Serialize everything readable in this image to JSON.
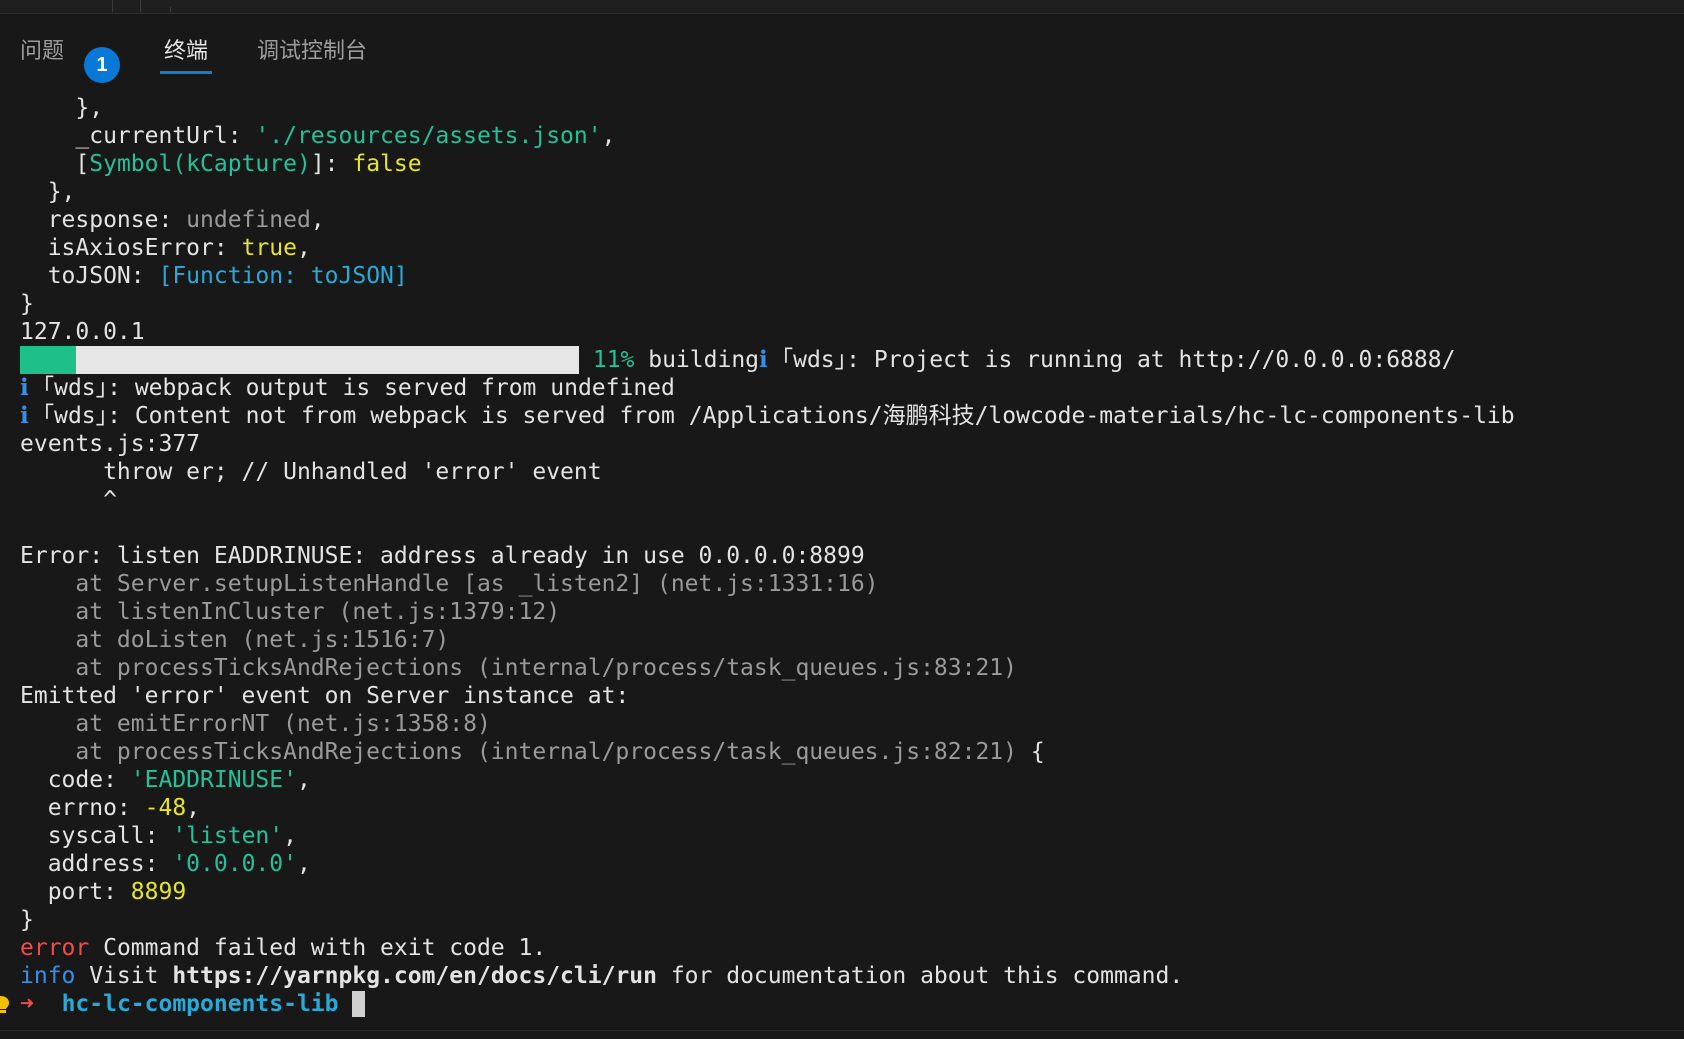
{
  "panel": {
    "tabs": {
      "problems": "问题",
      "problems_count": "1",
      "terminal": "终端",
      "debug_console": "调试控制台"
    }
  },
  "terminal": {
    "l01": "    },",
    "l02_key": "    _currentUrl: ",
    "l02_val": "'./resources/assets.json'",
    "l02_end": ",",
    "l03_open": "    [",
    "l03_sym": "Symbol(kCapture)",
    "l03_close": "]: ",
    "l03_val": "false",
    "l04": "  },",
    "l05_key": "  response: ",
    "l05_val": "undefined",
    "l05_end": ",",
    "l06_key": "  isAxiosError: ",
    "l06_val": "true",
    "l06_end": ",",
    "l07_key": "  toJSON: ",
    "l07_val": "[Function: toJSON]",
    "l08": "}",
    "l09": "127.0.0.1",
    "progress_percent": 10,
    "l10_pct": " 11%",
    "l10_text": " building",
    "l10_info": "ℹ",
    "l10_rest": " ｢wds｣: Project is running at http://0.0.0.0:6888/",
    "l11_info": "ℹ",
    "l11_rest": " ｢wds｣: webpack output is served from undefined",
    "l12_info": "ℹ",
    "l12_rest": " ｢wds｣: Content not from webpack is served from /Applications/海鹏科技/lowcode-materials/hc-lc-components-lib",
    "l13": "events.js:377",
    "l14": "      throw er; // Unhandled 'error' event",
    "l15": "      ^",
    "l16": "",
    "l17": "Error: listen EADDRINUSE: address already in use 0.0.0.0:8899",
    "l18": "    at Server.setupListenHandle [as _listen2] (net.js:1331:16)",
    "l19": "    at listenInCluster (net.js:1379:12)",
    "l20": "    at doListen (net.js:1516:7)",
    "l21": "    at processTicksAndRejections (internal/process/task_queues.js:83:21)",
    "l22": "Emitted 'error' event on Server instance at:",
    "l23": "    at emitErrorNT (net.js:1358:8)",
    "l24_dim": "    at processTicksAndRejections (internal/process/task_queues.js:82:21)",
    "l24_end": " {",
    "l25_key": "  code: ",
    "l25_val": "'EADDRINUSE'",
    "l25_end": ",",
    "l26_key": "  errno: ",
    "l26_val": "-48",
    "l26_end": ",",
    "l27_key": "  syscall: ",
    "l27_val": "'listen'",
    "l27_end": ",",
    "l28_key": "  address: ",
    "l28_val": "'0.0.0.0'",
    "l28_end": ",",
    "l29_key": "  port: ",
    "l29_val": "8899",
    "l30": "}",
    "l31_tag": "error",
    "l31_rest": " Command failed with exit code 1.",
    "l32_tag": "info",
    "l32_mid": " Visit ",
    "l32_url": "https://yarnpkg.com/en/docs/cli/run",
    "l32_rest": " for documentation about this command.",
    "prompt_arrow": "➜",
    "prompt_dir": "hc-lc-components-lib"
  },
  "icons": {
    "bulb": "lightbulb-icon",
    "cursor": "terminal-cursor"
  },
  "colors": {
    "background": "#181818",
    "string": "#23c29a",
    "literal": "#e6e52a",
    "dim": "#9a9a9a",
    "function": "#2aa9d6",
    "error": "#f14c4c",
    "info": "#3b8ee8",
    "accent": "#0a78d7"
  }
}
